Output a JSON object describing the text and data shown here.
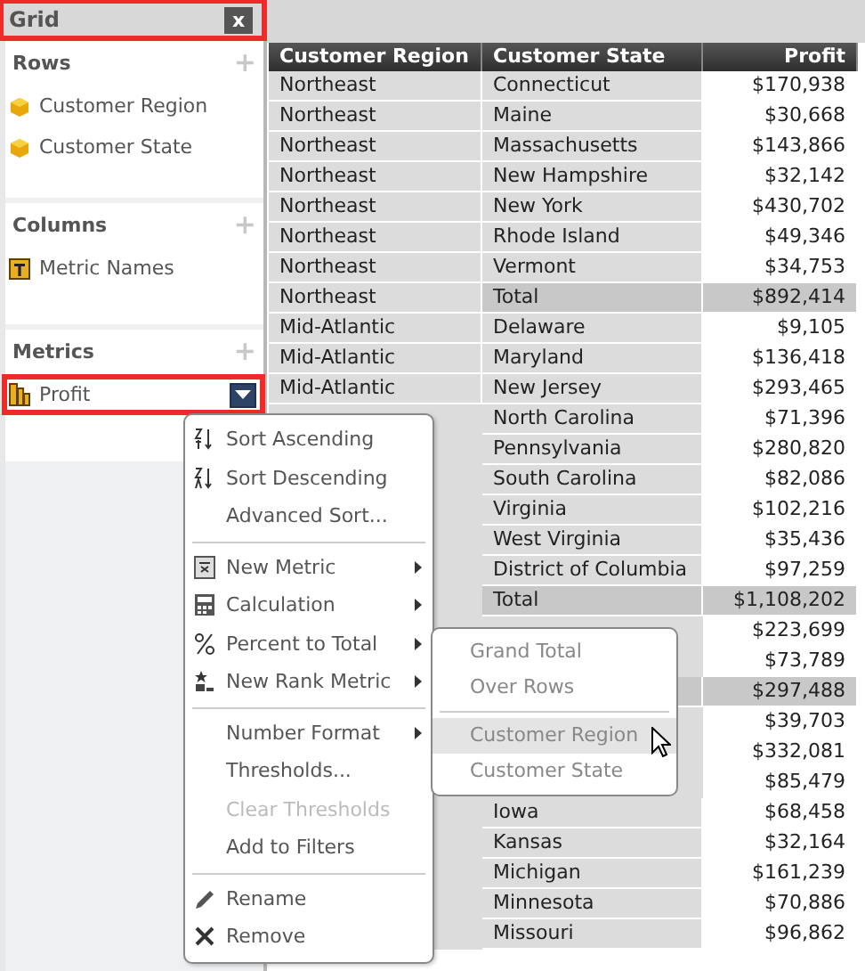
{
  "panel": {
    "title": "Grid",
    "highlighted": true,
    "close_label": "x",
    "sections": [
      {
        "title": "Rows",
        "add_label": "+",
        "items": [
          {
            "label": "Customer Region",
            "kind": "attribute",
            "highlighted": false,
            "menu": false
          },
          {
            "label": "Customer State",
            "kind": "attribute",
            "highlighted": false,
            "menu": false
          }
        ]
      },
      {
        "title": "Columns",
        "add_label": "+",
        "items": [
          {
            "label": "Metric Names",
            "kind": "names",
            "highlighted": false,
            "menu": false
          }
        ]
      },
      {
        "title": "Metrics",
        "add_label": "+",
        "items": [
          {
            "label": "Profit",
            "kind": "metric",
            "highlighted": true,
            "menu": true
          }
        ]
      }
    ]
  },
  "table": {
    "columns": [
      "Customer Region",
      "Customer State",
      "Profit"
    ],
    "rows": [
      {
        "region": "Northeast",
        "state": "Connecticut",
        "profit": "$170,938",
        "total": false
      },
      {
        "region": "Northeast",
        "state": "Maine",
        "profit": "$30,668",
        "total": false
      },
      {
        "region": "Northeast",
        "state": "Massachusetts",
        "profit": "$143,866",
        "total": false
      },
      {
        "region": "Northeast",
        "state": "New Hampshire",
        "profit": "$32,142",
        "total": false
      },
      {
        "region": "Northeast",
        "state": "New York",
        "profit": "$430,702",
        "total": false
      },
      {
        "region": "Northeast",
        "state": "Rhode Island",
        "profit": "$49,346",
        "total": false
      },
      {
        "region": "Northeast",
        "state": "Vermont",
        "profit": "$34,753",
        "total": false
      },
      {
        "region": "Northeast",
        "state": "Total",
        "profit": "$892,414",
        "total": true
      },
      {
        "region": "Mid-Atlantic",
        "state": "Delaware",
        "profit": "$9,105",
        "total": false
      },
      {
        "region": "Mid-Atlantic",
        "state": "Maryland",
        "profit": "$136,418",
        "total": false
      },
      {
        "region": "Mid-Atlantic",
        "state": "New Jersey",
        "profit": "$293,465",
        "total": false
      },
      {
        "state": "North Carolina",
        "profit": "$71,396",
        "total": false
      },
      {
        "state": "Pennsylvania",
        "profit": "$280,820",
        "total": false
      },
      {
        "state": "South Carolina",
        "profit": "$82,086",
        "total": false
      },
      {
        "state": "Virginia",
        "profit": "$102,216",
        "total": false
      },
      {
        "state": "West Virginia",
        "profit": "$35,436",
        "total": false
      },
      {
        "state": "District of Columbia",
        "profit": "$97,259",
        "total": false
      },
      {
        "state": "Total",
        "profit": "$1,108,202",
        "total": true
      },
      {
        "profit": "$223,699",
        "total": false
      },
      {
        "profit": "$73,789",
        "total": false
      },
      {
        "profit": "$297,488",
        "total": true
      },
      {
        "profit": "$39,703",
        "total": false
      },
      {
        "profit": "$332,081",
        "total": false
      },
      {
        "profit": "$85,479",
        "total": false
      },
      {
        "state": "Iowa",
        "profit": "$68,458",
        "total": false
      },
      {
        "state": "Kansas",
        "profit": "$32,164",
        "total": false
      },
      {
        "state": "Michigan",
        "profit": "$161,239",
        "total": false
      },
      {
        "state": "Minnesota",
        "profit": "$70,886",
        "total": false
      },
      {
        "state": "Missouri",
        "profit": "$96,862",
        "total": false
      }
    ]
  },
  "context_menu": {
    "groups": [
      [
        {
          "label": "Sort Ascending",
          "submenu": false,
          "disabled": false
        },
        {
          "label": "Sort Descending",
          "submenu": false,
          "disabled": false
        },
        {
          "label": "Advanced Sort...",
          "submenu": false,
          "disabled": false
        }
      ],
      [
        {
          "label": "New Metric",
          "submenu": true,
          "disabled": false
        },
        {
          "label": "Calculation",
          "submenu": true,
          "disabled": false
        },
        {
          "label": "Percent to Total",
          "submenu": true,
          "disabled": false
        },
        {
          "label": "New Rank Metric",
          "submenu": true,
          "disabled": false
        }
      ],
      [
        {
          "label": "Number Format",
          "submenu": true,
          "disabled": false
        },
        {
          "label": "Thresholds...",
          "submenu": false,
          "disabled": false
        },
        {
          "label": "Clear Thresholds",
          "submenu": false,
          "disabled": true
        },
        {
          "label": "Add to Filters",
          "submenu": false,
          "disabled": false
        }
      ],
      [
        {
          "label": "Rename",
          "submenu": false,
          "disabled": false
        },
        {
          "label": "Remove",
          "submenu": false,
          "disabled": false
        }
      ]
    ]
  },
  "submenu": {
    "groups": [
      [
        {
          "label": "Grand Total",
          "selected": false
        },
        {
          "label": "Over Rows",
          "selected": false
        }
      ],
      [
        {
          "label": "Customer Region",
          "selected": true
        },
        {
          "label": "Customer State",
          "selected": false
        }
      ]
    ]
  }
}
